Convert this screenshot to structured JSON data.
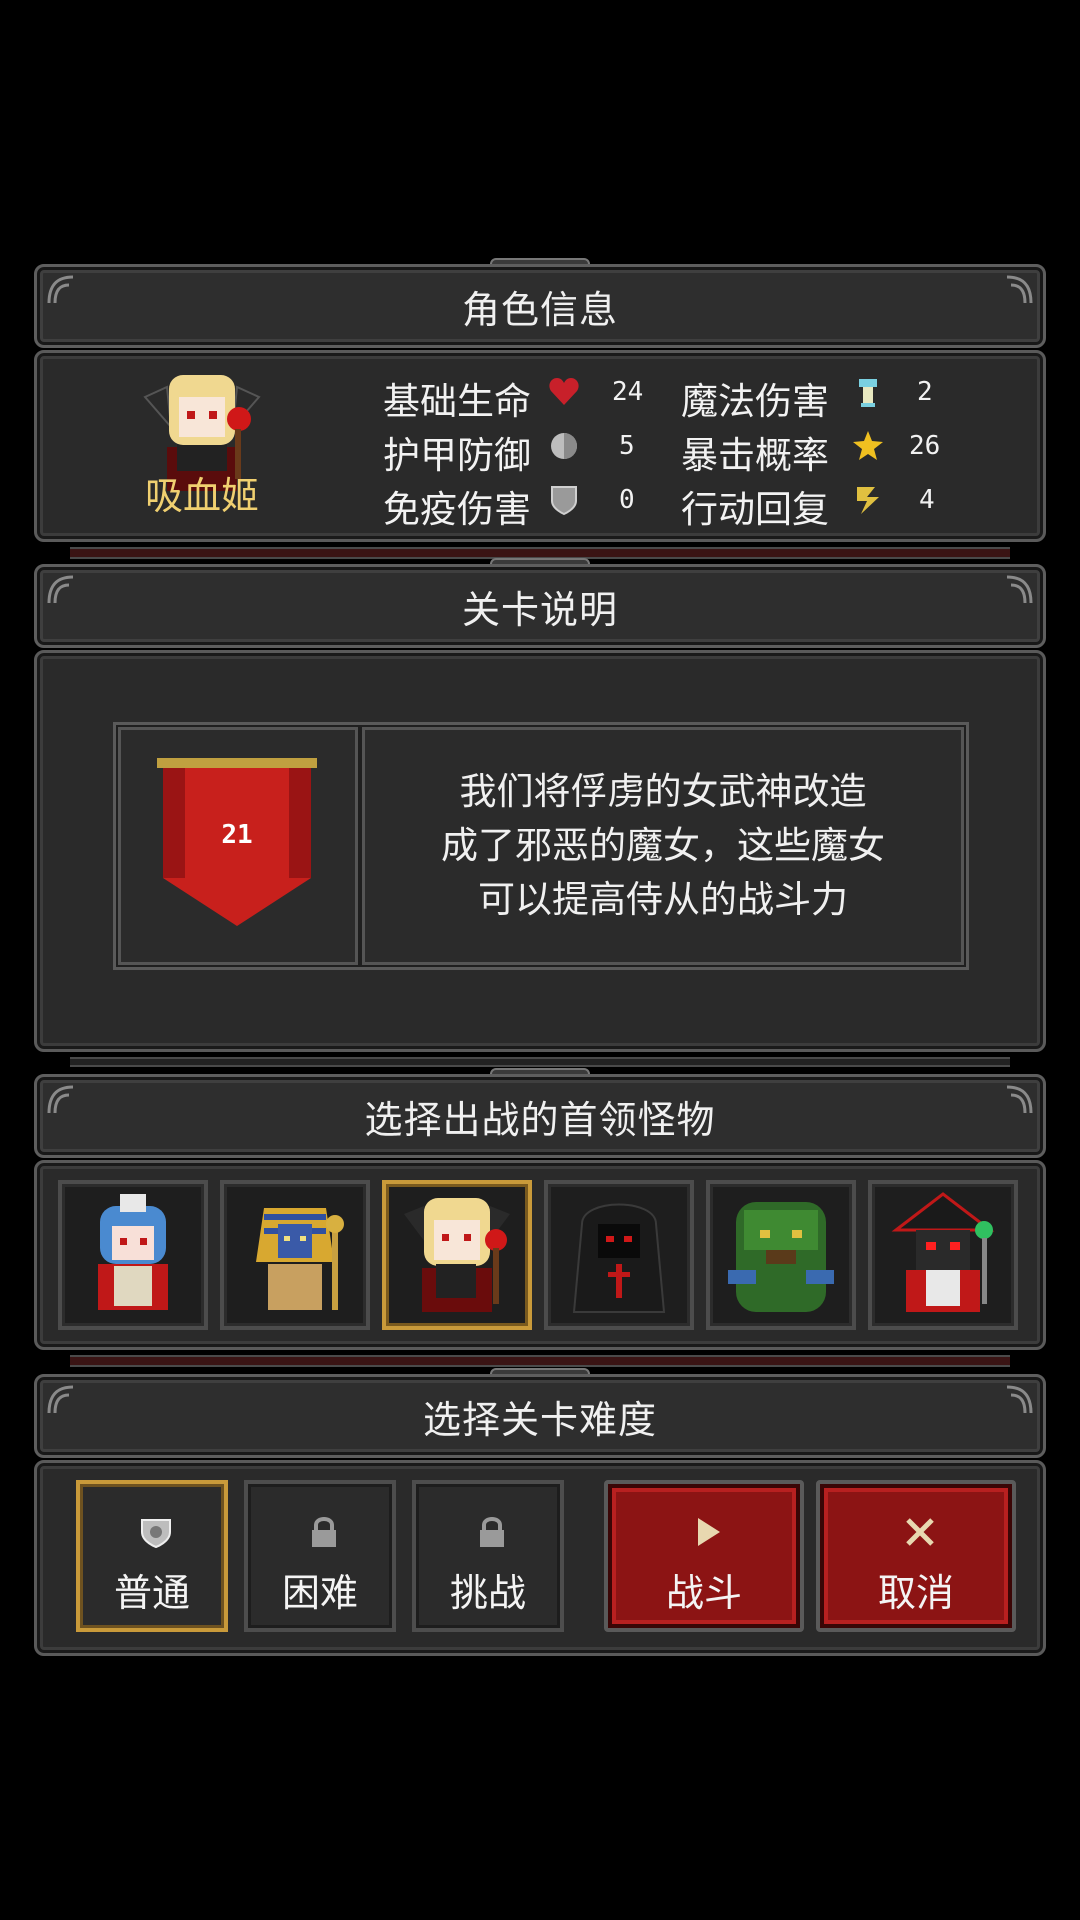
{
  "character_panel": {
    "title": "角色信息",
    "character_name": "吸血姬",
    "stats": [
      {
        "label": "基础生命",
        "value": "24",
        "icon": "heart-icon",
        "color": "#c8202a"
      },
      {
        "label": "护甲防御",
        "value": "5",
        "icon": "armor-orb-icon",
        "color": "#bdbdbd"
      },
      {
        "label": "免疫伤害",
        "value": "0",
        "icon": "shield-icon",
        "color": "#9a9a9a"
      },
      {
        "label": "魔法伤害",
        "value": "2",
        "icon": "magic-potion-icon",
        "color": "#7ad0e0"
      },
      {
        "label": "暴击概率",
        "value": "26",
        "icon": "crit-star-icon",
        "color": "#f0c020"
      },
      {
        "label": "行动回复",
        "value": "4",
        "icon": "lightning-icon",
        "color": "#e0c040"
      }
    ]
  },
  "stage_panel": {
    "title": "关卡说明",
    "stage_number": "21",
    "description": "我们将俘虏的女武神改造\n成了邪恶的魔女，这些魔女\n可以提高侍从的战斗力"
  },
  "boss_panel": {
    "title": "选择出战的首领怪物",
    "bosses": [
      {
        "name": "boss-blue-hair-witch",
        "selected": false
      },
      {
        "name": "boss-pharaoh",
        "selected": false
      },
      {
        "name": "boss-vampire-girl",
        "selected": true
      },
      {
        "name": "boss-hooded-reaper",
        "selected": false
      },
      {
        "name": "boss-treant",
        "selected": false
      },
      {
        "name": "boss-skeleton-mage",
        "selected": false
      }
    ]
  },
  "difficulty_panel": {
    "title": "选择关卡难度",
    "options": [
      {
        "label": "普通",
        "icon": "crest-icon",
        "selected": true
      },
      {
        "label": "困难",
        "icon": "lock-icon",
        "selected": false
      },
      {
        "label": "挑战",
        "icon": "lock-icon",
        "selected": false
      }
    ],
    "fight_label": "战斗",
    "cancel_label": "取消"
  },
  "colors": {
    "accent_gold": "#c99a3a",
    "button_red": "#8c1414",
    "banner_red": "#c8201c"
  }
}
